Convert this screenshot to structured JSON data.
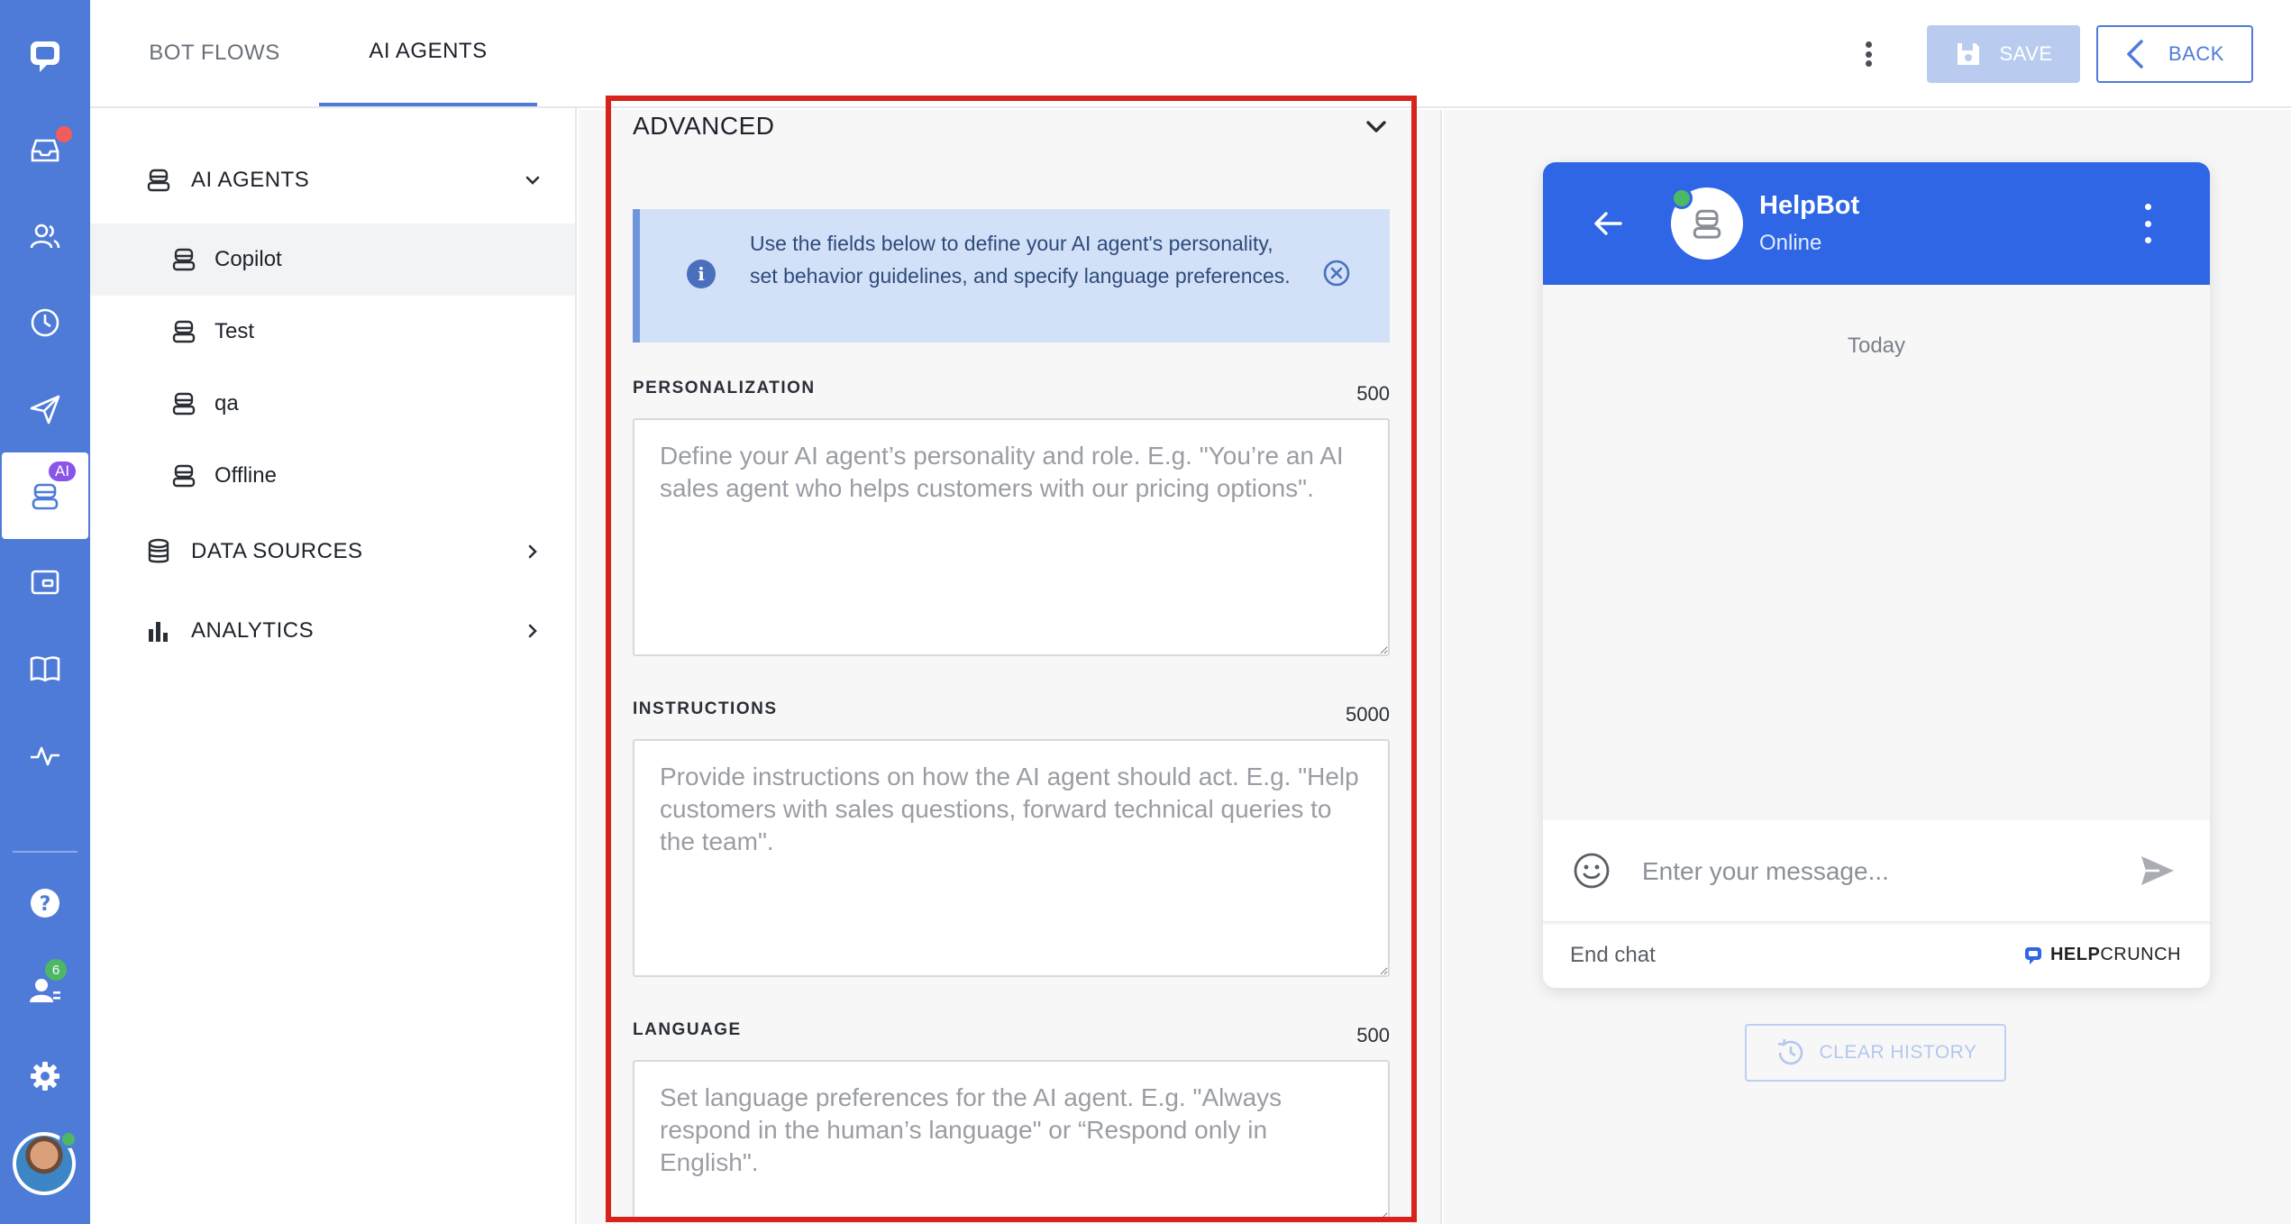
{
  "rail": {
    "items": [
      {
        "icon": "chat-logo-icon"
      },
      {
        "icon": "inbox-icon"
      },
      {
        "icon": "contacts-icon"
      },
      {
        "icon": "history-icon"
      },
      {
        "icon": "send-icon"
      },
      {
        "icon": "ai-bot-icon",
        "badge": "AI"
      },
      {
        "icon": "widget-icon"
      },
      {
        "icon": "knowledge-base-icon"
      },
      {
        "icon": "activity-icon"
      },
      {
        "icon": "help-icon"
      },
      {
        "icon": "team-icon",
        "badge": "6"
      },
      {
        "icon": "settings-icon"
      }
    ],
    "ai_badge": "AI",
    "team_badge": "6"
  },
  "topbar": {
    "tabs": [
      {
        "label": "BOT FLOWS"
      },
      {
        "label": "AI AGENTS"
      }
    ],
    "save_label": "SAVE",
    "back_label": "BACK"
  },
  "sidenav": {
    "groups": [
      {
        "label": "AI AGENTS"
      },
      {
        "label": "DATA SOURCES"
      },
      {
        "label": "ANALYTICS"
      }
    ],
    "agents": [
      {
        "label": "Copilot"
      },
      {
        "label": "Test"
      },
      {
        "label": "qa"
      },
      {
        "label": "Offline"
      }
    ]
  },
  "advanced": {
    "title": "ADVANCED",
    "info_text": "Use the fields below to define your AI agent's personality, set behavior guidelines, and specify language preferences.",
    "fields": [
      {
        "label": "PERSONALIZATION",
        "limit": "500",
        "value": "",
        "placeholder": "Define your AI agent’s personality and role. E.g. \"You’re an AI sales agent who helps customers with our pricing options\"."
      },
      {
        "label": "INSTRUCTIONS",
        "limit": "5000",
        "value": "",
        "placeholder": "Provide instructions on how the AI agent should act. E.g. \"Help customers with sales questions, forward technical queries to the team\"."
      },
      {
        "label": "LANGUAGE",
        "limit": "500",
        "value": "",
        "placeholder": "Set language preferences for the AI agent. E.g. \"Always respond in the human’s language\" or “Respond only in English\"."
      }
    ]
  },
  "preview": {
    "bot_name": "HelpBot",
    "bot_status": "Online",
    "date_divider": "Today",
    "message_placeholder": "Enter your message...",
    "message_value": "",
    "end_chat_label": "End chat",
    "brand_bold": "HELP",
    "brand_rest": "CRUNCH",
    "clear_history_label": "CLEAR HISTORY"
  },
  "colors": {
    "rail": "#4f7bd8",
    "widget_header": "#2e66e6",
    "highlight": "#d8231c",
    "info_bg": "#d2e1f8",
    "save_disabled": "#b9ccef",
    "online": "#4cb865"
  }
}
